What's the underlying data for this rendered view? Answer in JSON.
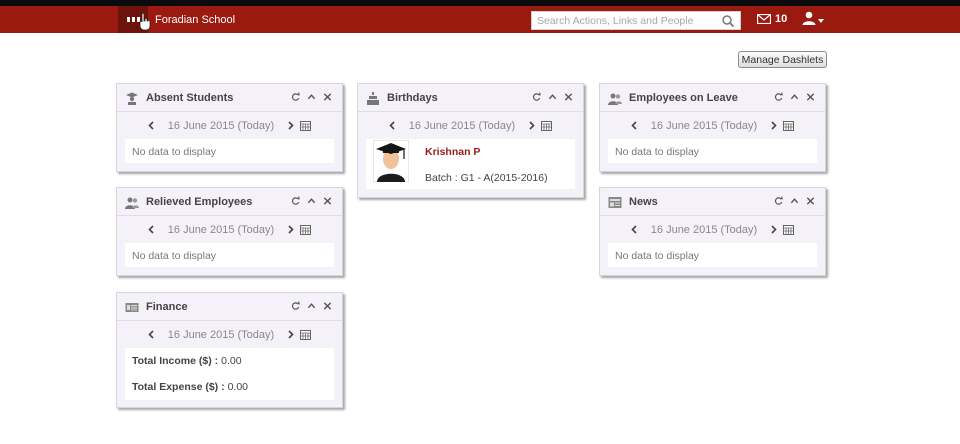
{
  "header": {
    "school_name": "Foradian School",
    "search_placeholder": "Search Actions, Links and People",
    "mail_count": "10",
    "nav_color": "#9a1a10"
  },
  "manage_label": "Manage Dashlets",
  "date_label": "16 June 2015 (Today)",
  "no_data": "No data to display",
  "dashlets": {
    "absent": {
      "title": "Absent Students",
      "icon": "graduate-icon"
    },
    "birthdays": {
      "title": "Birthdays",
      "icon": "cake-icon",
      "person": {
        "name": "Krishnan P",
        "batch": "Batch : G1 - A(2015-2016)"
      }
    },
    "leave": {
      "title": "Employees on Leave",
      "icon": "users-icon"
    },
    "relieved": {
      "title": "Relieved Employees",
      "icon": "users-icon"
    },
    "news": {
      "title": "News",
      "icon": "newspaper-icon"
    },
    "finance": {
      "title": "Finance",
      "icon": "finance-icon",
      "income_label": "Total Income ($) :",
      "income_value": "0.00",
      "expense_label": "Total Expense ($) :",
      "expense_value": "0.00"
    }
  }
}
